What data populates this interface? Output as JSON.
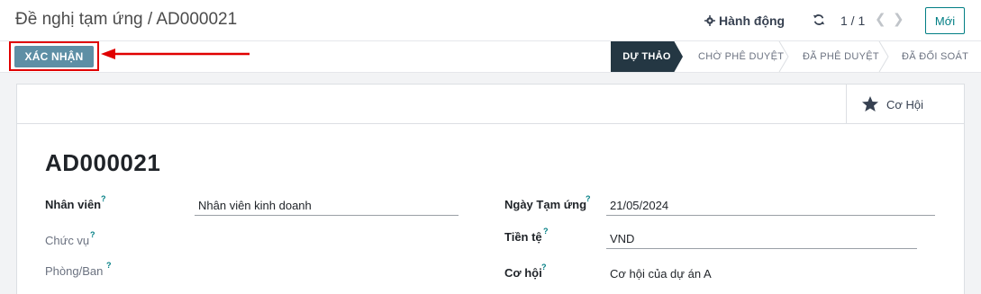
{
  "header": {
    "breadcrumb": "Đề nghị tạm ứng / AD000021",
    "actions_label": "Hành động",
    "pager": "1 / 1",
    "new_label": "Mới"
  },
  "statusbar": {
    "confirm_label": "XÁC NHẬN",
    "stages": [
      {
        "label": "DỰ THẢO",
        "active": true
      },
      {
        "label": "CHỜ PHÊ DUYỆT",
        "active": false
      },
      {
        "label": "ĐÃ PHÊ DUYỆT",
        "active": false
      },
      {
        "label": "ĐÃ ĐỐI SOÁT",
        "active": false
      }
    ]
  },
  "smart_button": {
    "label": "Cơ Hội",
    "icon": "star-icon"
  },
  "record": {
    "title": "AD000021",
    "fields_left": [
      {
        "label": "Nhân viên",
        "value": "Nhân viên kinh doanh",
        "help": "?"
      },
      {
        "label": "Chức vụ",
        "value": "",
        "help": "?"
      },
      {
        "label": "Phòng/Ban",
        "value": "",
        "help": "?"
      }
    ],
    "fields_right": [
      {
        "label": "Ngày Tạm ứng",
        "value": "21/05/2024",
        "help": "?"
      },
      {
        "label": "Tiền tệ",
        "value": "VND",
        "help": "?"
      },
      {
        "label": "Cơ hội",
        "value": "Cơ hội của dự án A",
        "help": "?"
      }
    ]
  },
  "colors": {
    "accent": "#017e84",
    "confirm_button": "#5e8fa5",
    "active_stage": "#243743",
    "annotation": "#e00000"
  }
}
